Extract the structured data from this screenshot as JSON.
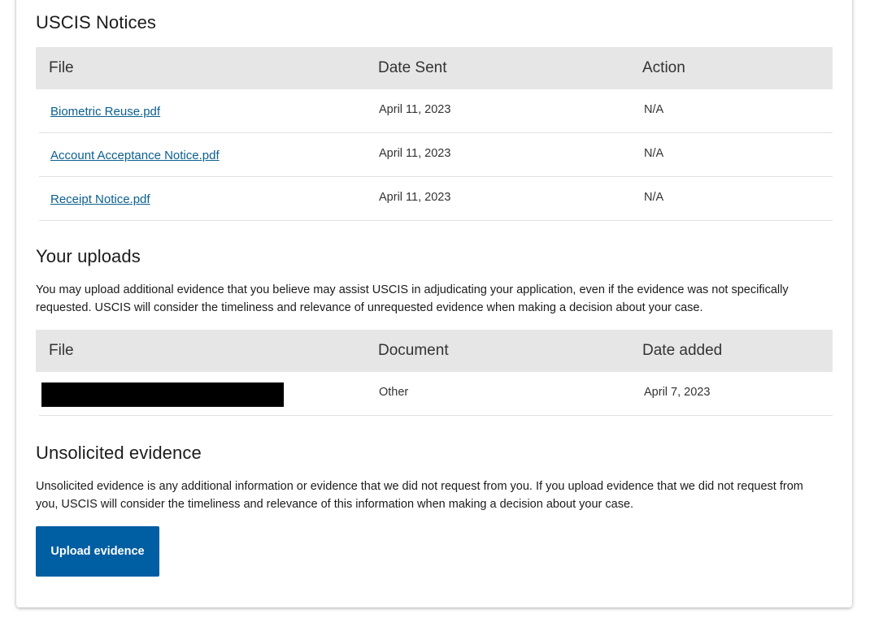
{
  "notices": {
    "title": "USCIS Notices",
    "columns": [
      "File",
      "Date Sent",
      "Action"
    ],
    "rows": [
      {
        "file": "Biometric Reuse.pdf",
        "date": "April 11, 2023",
        "action": "N/A"
      },
      {
        "file": "Account Acceptance Notice.pdf",
        "date": "April 11, 2023",
        "action": "N/A"
      },
      {
        "file": "Receipt Notice.pdf",
        "date": "April 11, 2023",
        "action": "N/A"
      }
    ]
  },
  "uploads": {
    "title": "Your uploads",
    "description": "You may upload additional evidence that you believe may assist USCIS in adjudicating your application, even if the evidence was not specifically requested. USCIS will consider the timeliness and relevance of unrequested evidence when making a decision about your case.",
    "columns": [
      "File",
      "Document",
      "Date added"
    ],
    "rows": [
      {
        "document": "Other",
        "date_added": "April 7, 2023"
      }
    ]
  },
  "unsolicited": {
    "title": "Unsolicited evidence",
    "description": "Unsolicited evidence is any additional information or evidence that we did not request from you. If you upload evidence that we did not request from you, USCIS will consider the timeliness and relevance of this information when making a decision about your case.",
    "button_label": "Upload evidence"
  },
  "colors": {
    "link": "#0b5f8f",
    "button": "#005ea2",
    "table_header": "#e6e6e6"
  }
}
